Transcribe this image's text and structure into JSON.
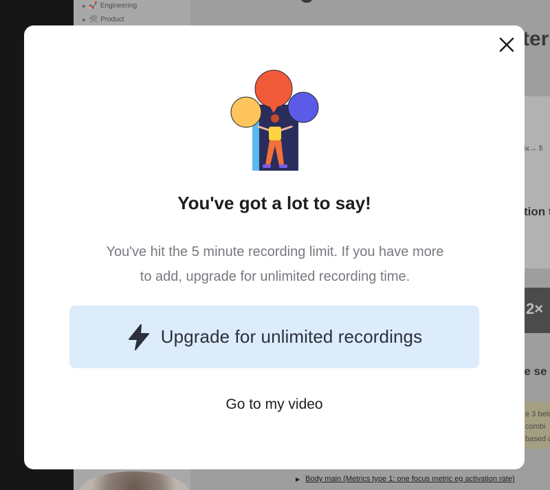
{
  "background": {
    "sidebar_items": [
      {
        "label": "Engineering",
        "icon": "rocket-icon"
      },
      {
        "label": "Product",
        "icon": "tools-icon"
      }
    ],
    "title_fragment": "ter",
    "text_fragments": [
      "ix→ fi",
      "tion t",
      "ne se",
      "e 3 belo",
      "combi",
      "based o"
    ],
    "playback_speed": "2×",
    "bottom_list_item": "Body main (Metrics type 1: one focus metric eg activation rate)"
  },
  "modal": {
    "close_icon": "close-icon",
    "illustration": "speech-bubbles-person-illustration",
    "headline": "You've got a lot to say!",
    "body_line_1": "You've hit the 5 minute recording limit. If you have more",
    "body_line_2": "to add, upgrade for unlimited recording time.",
    "upgrade_button": {
      "icon": "lightning-bolt-icon",
      "label": "Upgrade for unlimited recordings"
    },
    "secondary_link": "Go to my video"
  },
  "colors": {
    "upgrade_button_bg": "#dcecfb",
    "bubble_red": "#f25b3a",
    "bubble_yellow": "#ffc45c",
    "bubble_blue": "#5b5be8"
  }
}
